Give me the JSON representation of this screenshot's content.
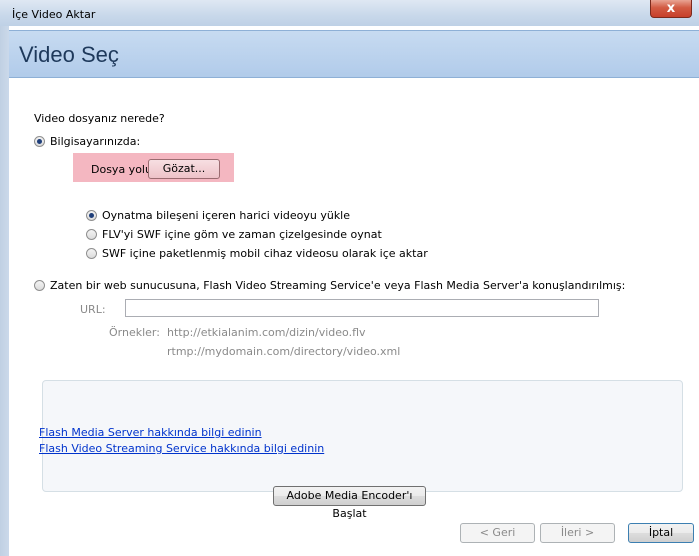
{
  "window": {
    "title": "İçe Video Aktar",
    "close_glyph": "x"
  },
  "header": {
    "heading": "Video Seç"
  },
  "question": "Video dosyanız nerede?",
  "computer_option": {
    "label": "Bilgisayarınızda:",
    "checked": true,
    "file_path_label": "Dosya yolu:",
    "browse_label": "Gözat..."
  },
  "sub_options": [
    {
      "label": "Oynatma bileşeni içeren harici videoyu yükle",
      "checked": true
    },
    {
      "label": "FLV'yi SWF içine göm ve zaman çizelgesinde oynat",
      "checked": false
    },
    {
      "label": "SWF içine paketlenmiş mobil cihaz videosu olarak içe aktar",
      "checked": false
    }
  ],
  "server_option": {
    "label": "Zaten bir web sunucusuna, Flash Video Streaming Service'e veya Flash Media Server'a konuşlandırılmış:",
    "checked": false,
    "url_label": "URL:",
    "url_value": "",
    "examples_label": "Örnekler:",
    "example_1": "http://etkialanim.com/dizin/video.flv",
    "example_2": "rtmp://mydomain.com/directory/video.xml"
  },
  "links": {
    "fms": "Flash Media Server hakkında bilgi edinin",
    "fvss": "Flash Video Streaming Service hakkında bilgi edinin"
  },
  "encoder_button": "Adobe Media Encoder'ı Başlat",
  "footer": {
    "back": "< Geri",
    "next": "İleri >",
    "cancel": "İptal"
  }
}
